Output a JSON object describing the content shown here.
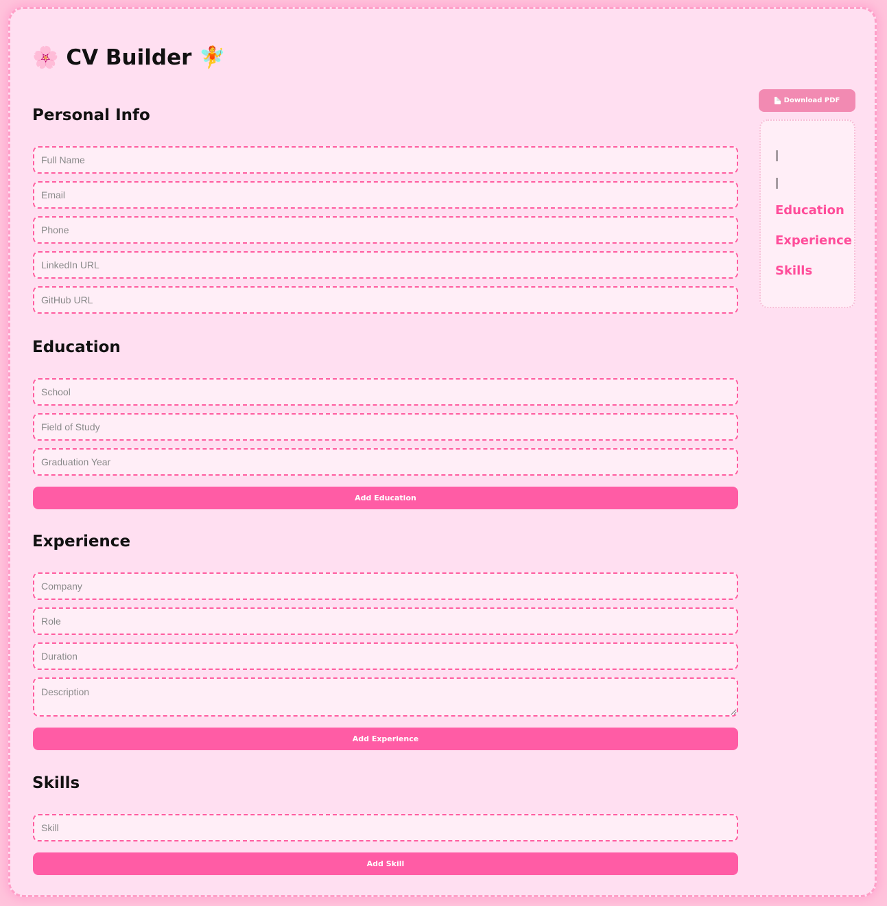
{
  "app": {
    "title": "🌸 CV Builder 🧚"
  },
  "personal": {
    "heading": "Personal Info",
    "full_name_placeholder": "Full Name",
    "email_placeholder": "Email",
    "phone_placeholder": "Phone",
    "linkedin_placeholder": "LinkedIn URL",
    "github_placeholder": "GitHub URL"
  },
  "education": {
    "heading": "Education",
    "school_placeholder": "School",
    "field_placeholder": "Field of Study",
    "year_placeholder": "Graduation Year",
    "add_label": "Add Education"
  },
  "experience": {
    "heading": "Experience",
    "company_placeholder": "Company",
    "role_placeholder": "Role",
    "duration_placeholder": "Duration",
    "description_placeholder": "Description",
    "add_label": "Add Experience"
  },
  "skills": {
    "heading": "Skills",
    "skill_placeholder": "Skill",
    "add_label": "Add Skill"
  },
  "download": {
    "label": "Download PDF",
    "icon": "document-icon"
  },
  "preview": {
    "line1": "|",
    "line2": "|",
    "education_heading": "Education",
    "experience_heading": "Experience",
    "skills_heading": "Skills"
  },
  "colors": {
    "accent": "#ff5ca5",
    "field_border": "#ff5c9f",
    "panel_background": "#ffdff1",
    "page_background": "#ffc4dc",
    "preview_heading": "#ff4d9a"
  }
}
